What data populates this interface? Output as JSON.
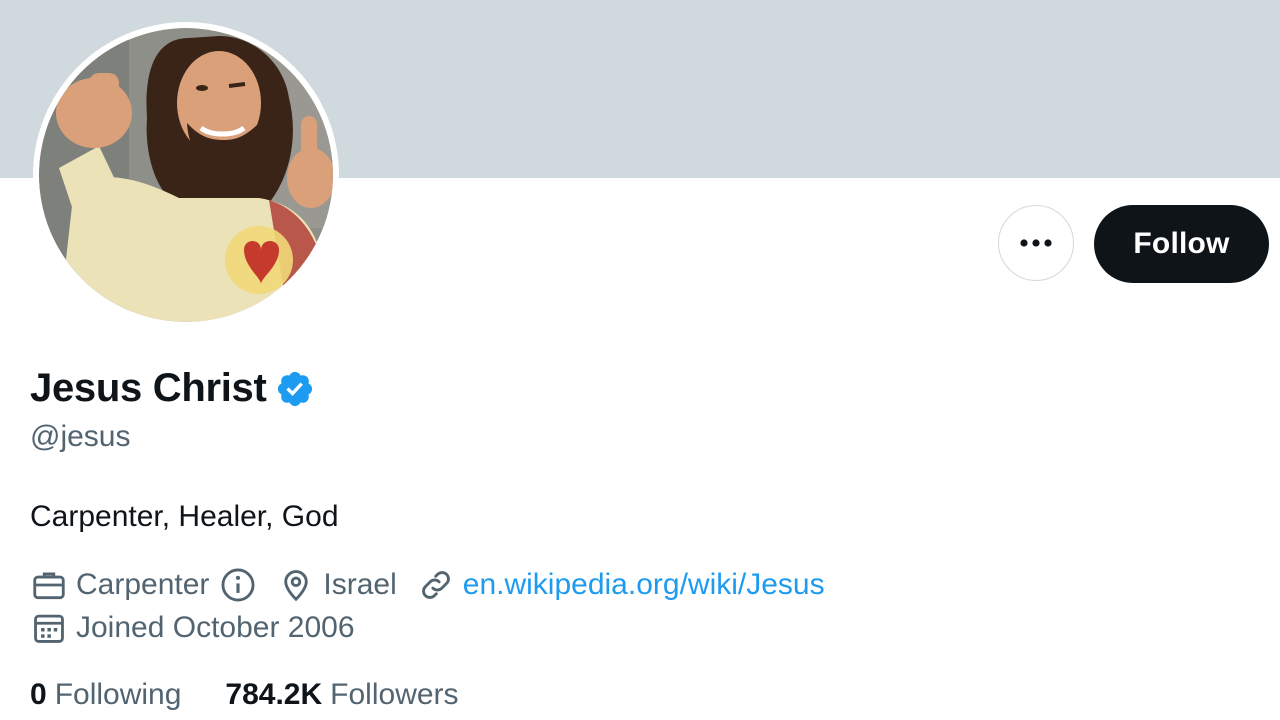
{
  "profile": {
    "display_name": "Jesus Christ",
    "handle": "@jesus",
    "bio": "Carpenter, Healer, God",
    "verified": true
  },
  "meta": {
    "profession": "Carpenter",
    "location": "Israel",
    "website": "en.wikipedia.org/wiki/Jesus",
    "joined": "Joined October 2006"
  },
  "stats": {
    "following_count": "0",
    "following_label": "Following",
    "followers_count": "784.2K",
    "followers_label": "Followers"
  },
  "actions": {
    "follow_label": "Follow"
  },
  "icons": {
    "more": "more-horizontal-icon",
    "verified": "verified-badge-icon",
    "profession": "briefcase-icon",
    "info": "info-icon",
    "location": "location-pin-icon",
    "website": "link-icon",
    "joined": "calendar-icon"
  },
  "colors": {
    "banner": "#cfd9de",
    "accent": "#1d9bf0",
    "primary_text": "#0f1419",
    "secondary_text": "#536471",
    "follow_button": "#0f1419"
  }
}
